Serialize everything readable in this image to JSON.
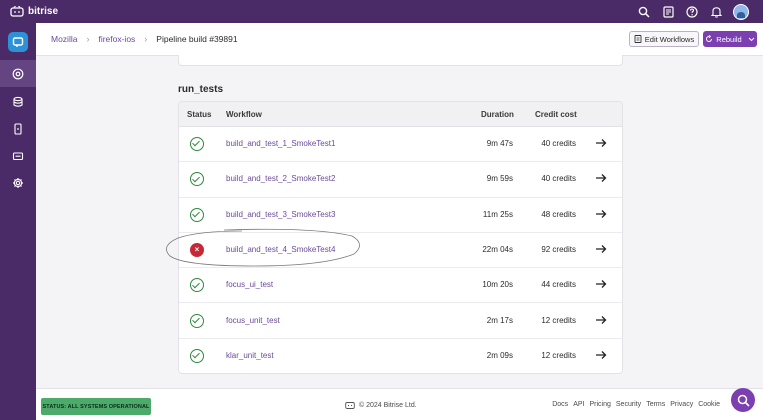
{
  "brand": {
    "name": "bitrise"
  },
  "topbar": {
    "icons": [
      "search-icon",
      "document-icon",
      "help-icon",
      "bell-icon",
      "avatar"
    ]
  },
  "sidebar": {
    "items": [
      "builds-icon",
      "database-icon",
      "device-icon",
      "release-icon",
      "settings-icon"
    ],
    "active": "builds-icon"
  },
  "breadcrumb": {
    "items": [
      "Mozilla",
      "firefox-ios"
    ],
    "current": "Pipeline build #39891"
  },
  "actions": {
    "edit_workflows": "Edit Workflows",
    "rebuild": "Rebuild"
  },
  "section": {
    "title": "run_tests"
  },
  "table": {
    "headers": {
      "status": "Status",
      "workflow": "Workflow",
      "duration": "Duration",
      "credit_cost": "Credit cost"
    },
    "rows": [
      {
        "status": "success",
        "workflow": "build_and_test_1_SmokeTest1",
        "duration": "9m 47s",
        "credits": "40 credits"
      },
      {
        "status": "success",
        "workflow": "build_and_test_2_SmokeTest2",
        "duration": "9m 59s",
        "credits": "40 credits"
      },
      {
        "status": "success",
        "workflow": "build_and_test_3_SmokeTest3",
        "duration": "11m 25s",
        "credits": "48 credits"
      },
      {
        "status": "failed",
        "workflow": "build_and_test_4_SmokeTest4",
        "duration": "22m 04s",
        "credits": "92 credits"
      },
      {
        "status": "success",
        "workflow": "focus_ui_test",
        "duration": "10m 20s",
        "credits": "44 credits"
      },
      {
        "status": "success",
        "workflow": "focus_unit_test",
        "duration": "2m 17s",
        "credits": "12 credits"
      },
      {
        "status": "success",
        "workflow": "klar_unit_test",
        "duration": "2m 09s",
        "credits": "12 credits"
      }
    ]
  },
  "footer": {
    "status": "STATUS: ALL SYSTEMS OPERATIONAL",
    "copyright": "© 2024 Bitrise Ltd.",
    "links": [
      "Docs",
      "API",
      "Pricing",
      "Security",
      "Terms",
      "Privacy",
      "Cookie"
    ]
  },
  "colors": {
    "brand_purple": "#4b2b67",
    "accent": "#7b3fb0",
    "success": "#2e8a3e",
    "failure": "#c62836",
    "status_green": "#4caa6b"
  }
}
